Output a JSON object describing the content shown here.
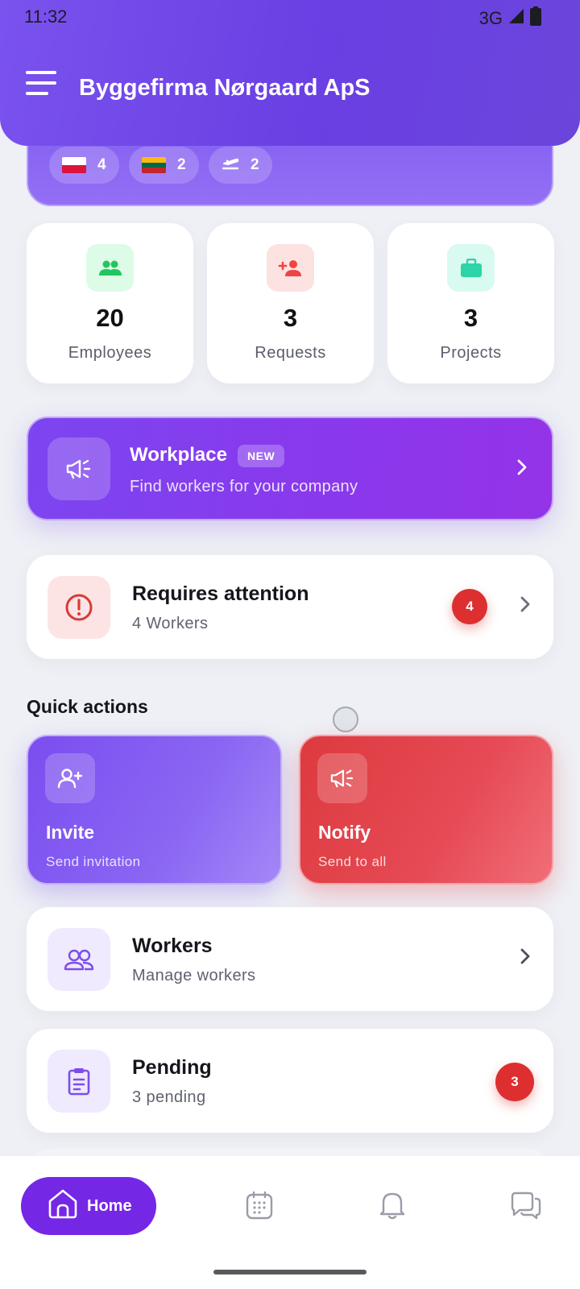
{
  "status": {
    "time": "11:32",
    "network": "3G"
  },
  "header": {
    "title": "Byggefirma Nørgaard ApS"
  },
  "overview": {
    "chips": [
      {
        "flag": "poland",
        "count": "4"
      },
      {
        "flag": "lithuania",
        "count": "2"
      },
      {
        "icon": "plane-departure-icon",
        "count": "2"
      }
    ]
  },
  "stats": [
    {
      "value": "20",
      "label": "Employees",
      "icon": "people-icon",
      "color": "#22c55e"
    },
    {
      "value": "3",
      "label": "Requests",
      "icon": "person-add-icon",
      "color": "#ef4444"
    },
    {
      "value": "3",
      "label": "Projects",
      "icon": "briefcase-icon",
      "color": "#2dd4a8"
    }
  ],
  "workplace": {
    "title": "Workplace",
    "badge": "NEW",
    "subtitle": "Find workers for your company"
  },
  "attention": {
    "title": "Requires attention",
    "subtitle": "4 Workers",
    "badge": "4"
  },
  "quick_actions": {
    "title": "Quick actions",
    "invite": {
      "title": "Invite",
      "subtitle": "Send invitation"
    },
    "notify": {
      "title": "Notify",
      "subtitle": "Send to all"
    }
  },
  "workers": {
    "title": "Workers",
    "subtitle": "Manage workers"
  },
  "pending": {
    "title": "Pending",
    "subtitle": "3 pending",
    "badge": "3"
  },
  "nav": {
    "home_label": "Home"
  },
  "colors": {
    "primary": "#7527e6",
    "danger": "#dd2f2f"
  }
}
